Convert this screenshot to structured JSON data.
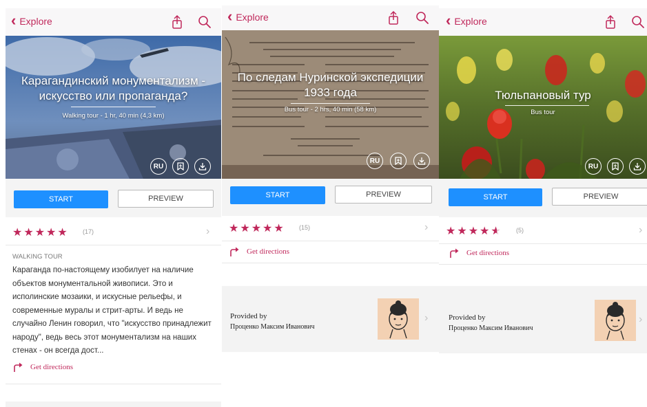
{
  "colors": {
    "accent": "#c0285b",
    "start": "#1e90ff"
  },
  "nav": {
    "back_label": "Explore",
    "share_icon": "share-icon",
    "search_icon": "search-icon"
  },
  "panels": [
    {
      "hero_title": "Карагандинский монументализм - искусство или пропаганда?",
      "hero_subtitle": "Walking tour - 1 hr, 40 min (4,3 km)",
      "language_badge": "RU",
      "start_label": "START",
      "preview_label": "PREVIEW",
      "rating": {
        "stars": 5,
        "count": "(17)"
      },
      "tour_type": "WALKING TOUR",
      "description": "Караганда по-настоящему изобилует на наличие объектов монументальной живописи. Это и исполинские мозаики, и искусные рельефы, и современные муралы и стрит-арты. И ведь не случайно Ленин говорил, что \"искусство принадлежит народу\", ведь весь этот монументализм на наших стенах - он всегда дост...",
      "directions_label": "Get directions"
    },
    {
      "hero_title": "По следам Нуринской экспедиции 1933 года",
      "hero_subtitle": "Bus tour - 2 hrs, 40 min (58 km)",
      "language_badge": "RU",
      "start_label": "START",
      "preview_label": "PREVIEW",
      "rating": {
        "stars": 5,
        "count": "(15)"
      },
      "directions_label": "Get directions",
      "provided_by": "Provided by",
      "provider_name": "Проценко Максим Иванович"
    },
    {
      "hero_title": "Тюльпановый тур",
      "hero_subtitle": "Bus tour",
      "language_badge": "RU",
      "start_label": "START",
      "preview_label": "PREVIEW",
      "rating": {
        "stars": 4.5,
        "count": "(5)"
      },
      "directions_label": "Get directions",
      "provided_by": "Provided by",
      "provider_name": "Проценко Максим Иванович"
    }
  ]
}
